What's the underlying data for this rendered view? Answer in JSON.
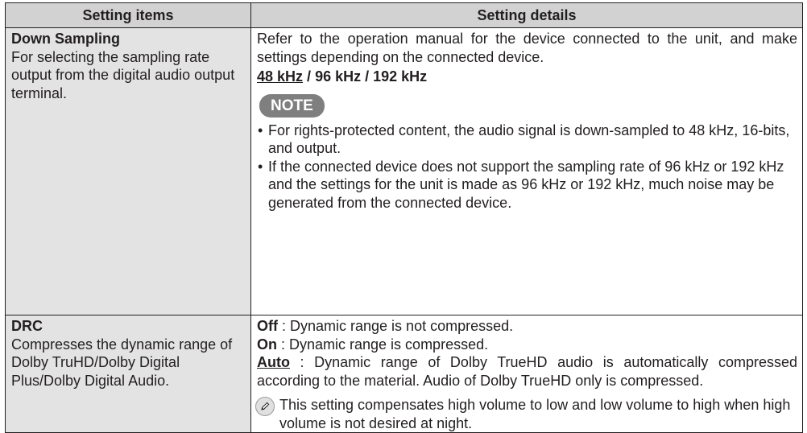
{
  "table": {
    "header": {
      "col1": "Setting items",
      "col2": "Setting details"
    },
    "rows": [
      {
        "title": "Down Sampling",
        "description": "For selecting the sampling rate output from the digital audio output terminal.",
        "intro": "Refer to the operation manual for the device connected to the unit, and make settings depending on the connected device.",
        "options": {
          "default": "48 kHz",
          "sep1": " / ",
          "opt2": "96 kHz",
          "sep2": " / ",
          "opt3": "192 kHz"
        },
        "note_label": "NOTE",
        "notes": [
          "For rights-protected content, the audio signal is down-sampled to 48 kHz, 16-bits, and output.",
          "If the connected device does not support the sampling rate of 96 kHz or 192 kHz and the settings for the unit is made as 96 kHz or 192 kHz, much noise may be generated from the connected device."
        ],
        "bullet": "•"
      },
      {
        "title": "DRC",
        "description": "Compresses the dynamic range of Dolby TruHD/Dolby Digital Plus/Dolby Digital Audio.",
        "choices": [
          {
            "name": "Off",
            "desc": " : Dynamic range is not compressed."
          },
          {
            "name": "On",
            "desc": " : Dynamic range is compressed."
          },
          {
            "name": "Auto",
            "desc": " : Dynamic range of Dolby TrueHD audio is automatically compressed according to the material. Audio of Dolby TrueHD only is compressed."
          }
        ],
        "memo_icon": "pencil-icon",
        "memo": "This setting compensates high volume to low and low volume to high when high volume is not desired at night."
      }
    ]
  }
}
